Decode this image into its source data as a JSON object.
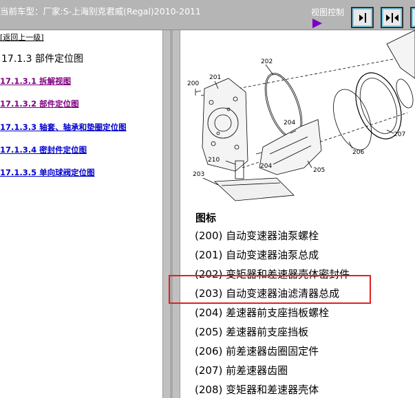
{
  "header": {
    "title": "当前车型：厂家:S-上海别克君威(Regal)2010-2011",
    "view_control_label": "视图控制"
  },
  "left": {
    "back_link": "[返回上一级]",
    "section_title": "17.1.3 部件定位图",
    "toc": [
      {
        "label": "17.1.3.1 拆解视图",
        "state": "visited"
      },
      {
        "label": "17.1.3.2 部件定位图",
        "state": "visited"
      },
      {
        "label": "17.1.3.3 轴套、轴承和垫圈定位图",
        "state": "link"
      },
      {
        "label": "17.1.3.4 密封件定位图",
        "state": "link"
      },
      {
        "label": "17.1.3.5 单向球阀定位图",
        "state": "link"
      }
    ]
  },
  "diagram": {
    "callouts": [
      "200",
      "201",
      "202",
      "203",
      "204",
      "204",
      "205",
      "206",
      "207",
      "210"
    ]
  },
  "legend": {
    "title": "图标",
    "items": [
      "(200) 自动变速器油泵螺栓",
      "(201) 自动变速器油泵总成",
      "(202) 变矩器和差速器壳体密封件",
      "(203) 自动变速器油滤清器总成",
      "(204) 差速器前支座挡板螺栓",
      "(205) 差速器前支座挡板",
      "(206) 前差速器齿圈固定件",
      "(207) 前差速器齿圈",
      "(208) 变矩器和差速器壳体"
    ]
  },
  "colors": {
    "visited_link": "#800080",
    "link": "#0000cc",
    "highlight": "#e02020",
    "header_bg": "#b5b5b5",
    "play_icon": "#7a00c8"
  }
}
